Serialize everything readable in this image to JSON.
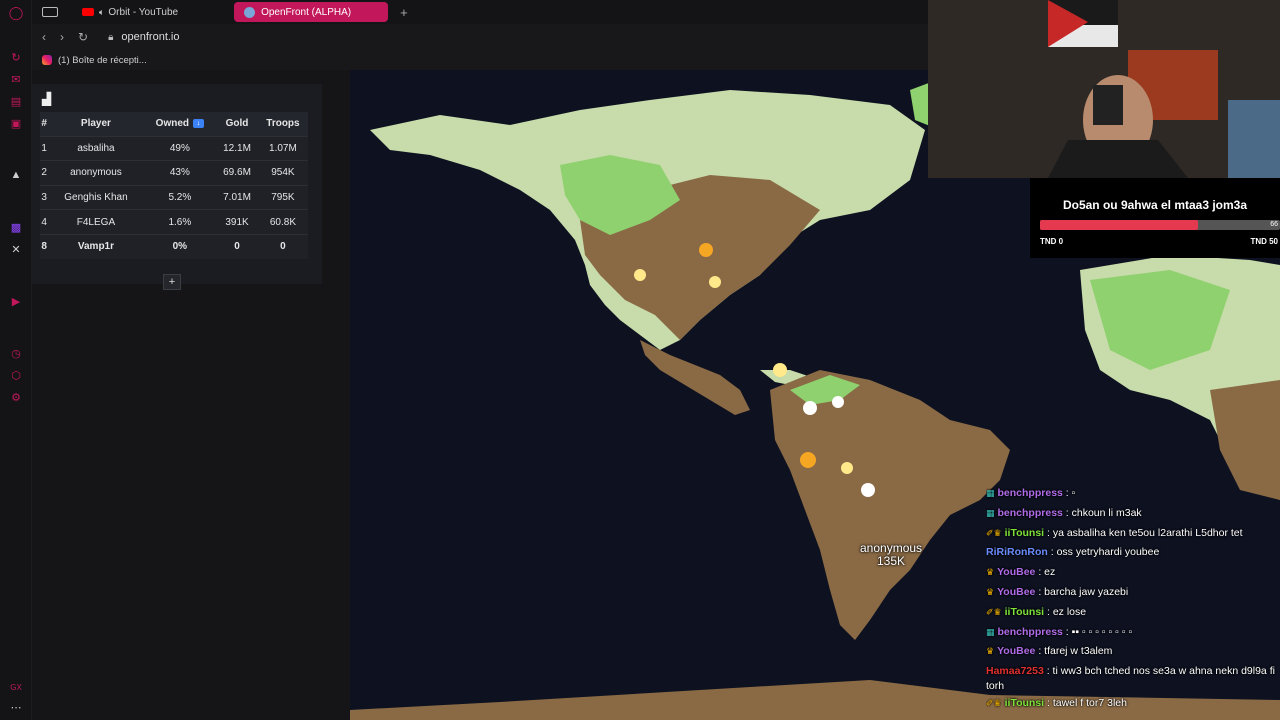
{
  "browser": {
    "tabs": [
      {
        "label": "Orbit - YouTube"
      },
      {
        "label": "OpenFront (ALPHA)"
      }
    ],
    "url": "openfront.io",
    "bookmark": "(1) Boîte de récepti..."
  },
  "leaderboard": {
    "columns": [
      "#",
      "Player",
      "Owned",
      "Gold",
      "Troops"
    ],
    "sort_icon": "↓",
    "rows": [
      {
        "rank": "1",
        "player": "asbaliha",
        "owned": "49%",
        "gold": "12.1M",
        "troops": "1.07M"
      },
      {
        "rank": "2",
        "player": "anonymous",
        "owned": "43%",
        "gold": "69.6M",
        "troops": "954K"
      },
      {
        "rank": "3",
        "player": "Genghis Khan",
        "owned": "5.2%",
        "gold": "7.01M",
        "troops": "795K"
      },
      {
        "rank": "4",
        "player": "F4LEGA",
        "owned": "1.6%",
        "gold": "391K",
        "troops": "60.8K"
      },
      {
        "rank": "8",
        "player": "Vamp1r",
        "owned": "0%",
        "gold": "0",
        "troops": "0"
      }
    ],
    "expand_label": "+"
  },
  "map": {
    "player_name": "anonymous",
    "player_troops": "135K"
  },
  "goal": {
    "title": "Do5an ou 9ahwa el mtaa3 jom3a",
    "progress": 66,
    "progress_label": "66",
    "min_label": "TND 0",
    "max_label": "TND 50"
  },
  "chat": [
    {
      "user": "benchppress",
      "color": "#b06ce8",
      "badge": "▦",
      "badge_color": "#39c5bb",
      "text": " : ▫"
    },
    {
      "user": "benchppress",
      "color": "#b06ce8",
      "badge": "▦",
      "badge_color": "#39c5bb",
      "text": " : chkoun li m3ak"
    },
    {
      "user": "iiTounsi",
      "color": "#7ee23a",
      "badge": "✐♛",
      "badge_color": "#f5b400",
      "text": " : ya asbaliha ken te5ou l2arathi L5dhor tet"
    },
    {
      "user": "RiRiRonRon",
      "color": "#6b8cff",
      "badge": "",
      "badge_color": "#fff",
      "text": " : oss yetryhardi youbee"
    },
    {
      "user": "YouBee",
      "color": "#b06ce8",
      "badge": "♛",
      "badge_color": "#f5b400",
      "text": " : ez"
    },
    {
      "user": "YouBee",
      "color": "#b06ce8",
      "badge": "♛",
      "badge_color": "#f5b400",
      "text": " : barcha jaw yazebi"
    },
    {
      "user": "iiTounsi",
      "color": "#7ee23a",
      "badge": "✐♛",
      "badge_color": "#f5b400",
      "text": " : ez lose"
    },
    {
      "user": "benchppress",
      "color": "#b06ce8",
      "badge": "▦",
      "badge_color": "#39c5bb",
      "text": " : ▪▪ ▫ ▫ ▫ ▫ ▫ ▫ ▫ ▫"
    },
    {
      "user": "YouBee",
      "color": "#b06ce8",
      "badge": "♛",
      "badge_color": "#f5b400",
      "text": " : tfarej w t3alem"
    },
    {
      "user": "Hamaa7253",
      "color": "#e03030",
      "badge": "",
      "badge_color": "#fff",
      "text": " : ti ww3 bch tched nos se3a w ahna nekn d9l9a fi torh"
    },
    {
      "user": "iiTounsi",
      "color": "#7ee23a",
      "badge": "✐♛",
      "badge_color": "#f5b400",
      "text": " : tawel f tor7 3leh"
    }
  ]
}
